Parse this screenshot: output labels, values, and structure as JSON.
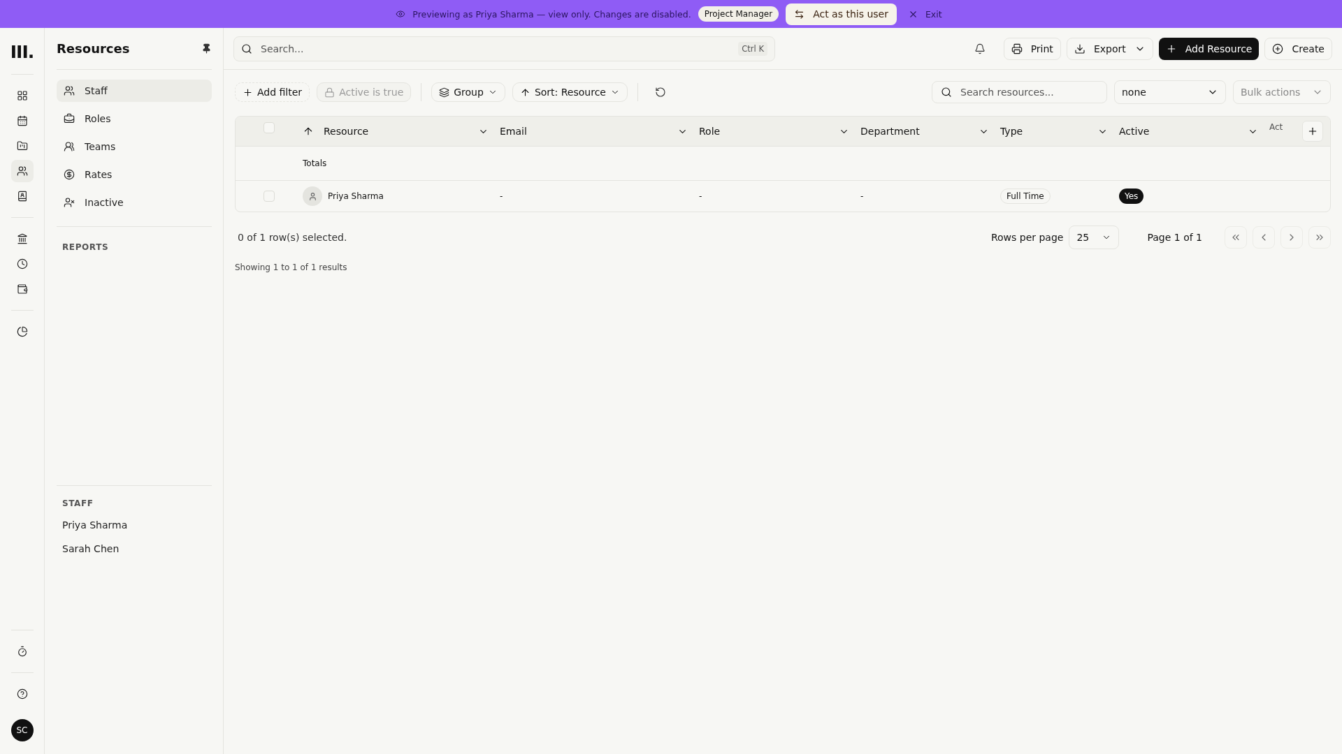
{
  "banner": {
    "message": "Previewing as Priya Sharma — view only. Changes are disabled.",
    "role_badge": "Project Manager",
    "act_button": "Act as this user",
    "exit": "Exit"
  },
  "rail": {
    "logo": "III.",
    "groups": [
      [
        {
          "selected": false
        },
        {
          "selected": false
        },
        {
          "selected": false
        },
        {
          "selected": true
        },
        {
          "selected": false
        }
      ],
      [
        {
          "selected": false
        },
        {
          "selected": false
        },
        {
          "selected": false
        }
      ],
      [
        {
          "selected": false
        }
      ]
    ],
    "bottom": [
      {
        "selected": false
      }
    ],
    "avatar": "SC"
  },
  "sidebar": {
    "title": "Resources",
    "nav": [
      {
        "label": "Staff",
        "selected": true
      },
      {
        "label": "Roles",
        "selected": false
      },
      {
        "label": "Teams",
        "selected": false
      },
      {
        "label": "Rates",
        "selected": false
      },
      {
        "label": "Inactive",
        "selected": false
      }
    ],
    "reports_heading": "REPORTS",
    "staff_heading": "STAFF",
    "staff": [
      "Priya Sharma",
      "Sarah Chen"
    ]
  },
  "header": {
    "search_placeholder": "Search...",
    "shortcut": "Ctrl K",
    "print": "Print",
    "export": "Export",
    "add": "Add Resource",
    "create": "Create"
  },
  "toolbar": {
    "add_filter": "Add filter",
    "locked_filter": {
      "label": "Active is true",
      "disabled": true
    },
    "group": "Group",
    "sort": "Sort: Resource",
    "search_placeholder": "Search resources...",
    "view_select": "none",
    "bulk_actions": {
      "label": "Bulk actions",
      "disabled": true
    }
  },
  "table": {
    "columns": [
      {
        "label": "Resource",
        "sorted": true
      },
      {
        "label": "Email",
        "sorted": false
      },
      {
        "label": "Role",
        "sorted": false
      },
      {
        "label": "Department",
        "sorted": false
      },
      {
        "label": "Type",
        "sorted": false
      },
      {
        "label": "Active",
        "sorted": false
      }
    ],
    "column_7": "Act",
    "all_selected": false,
    "totals_label": "Totals",
    "rows": [
      {
        "selected": false,
        "resource": "Priya Sharma",
        "email": "-",
        "role": "-",
        "department": "-",
        "type": "Full Time",
        "active": "Yes"
      }
    ]
  },
  "footer": {
    "selection": "0 of 1 row(s) selected.",
    "rows_per_page_label": "Rows per page",
    "rows_per_page": "25",
    "page": "Page 1 of 1",
    "showing": "Showing 1 to 1 of 1 results"
  }
}
